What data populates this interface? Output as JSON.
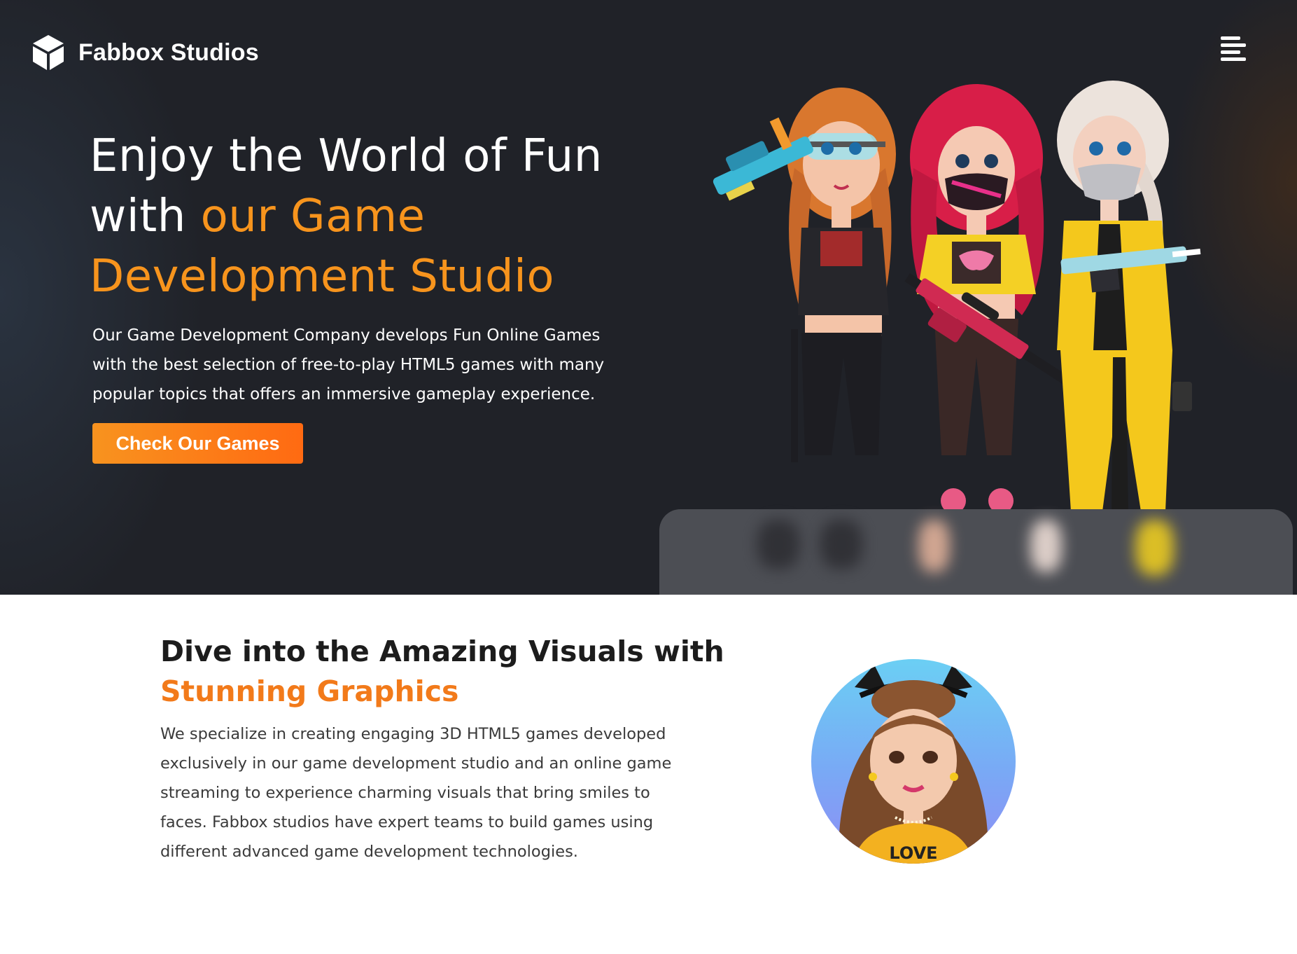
{
  "header": {
    "brand_name": "Fabbox Studios",
    "logo_icon": "cube-logo-icon",
    "menu_icon": "hamburger-menu-icon"
  },
  "hero": {
    "title_line_1": "Enjoy the World of Fun",
    "title_line_2_prefix": "with ",
    "title_line_2_accent": "our Game",
    "title_line_3_accent": "Development Studio",
    "description": "Our Game Development Company develops Fun Online Games with the best selection of free-to-play HTML5 games with many popular topics that offers an immersive gameplay experience.",
    "cta_label": "Check Our Games",
    "accent_color": "#f7941d",
    "background_color": "#202228"
  },
  "visuals": {
    "title_prefix": "Dive into the Amazing Visuals with",
    "title_accent": "Stunning Graphics",
    "description": "We specialize in creating engaging 3D HTML5 games developed exclusively in our game development studio and an online game streaming to experience charming visuals that bring smiles to faces. Fabbox studios have expert teams to build games using different advanced game development technologies.",
    "avatar_shirt_text": "LOVE"
  }
}
